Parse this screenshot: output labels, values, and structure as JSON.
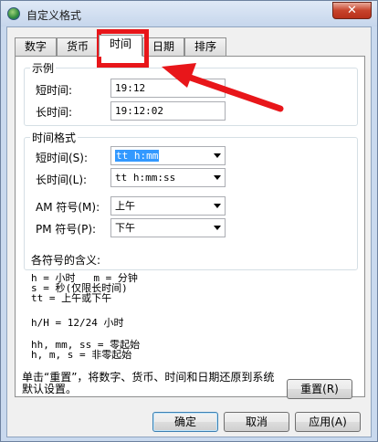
{
  "window": {
    "title": "自定义格式",
    "close_label": "✕"
  },
  "tabs": [
    {
      "label": "数字"
    },
    {
      "label": "货币"
    },
    {
      "label": "时间"
    },
    {
      "label": "日期"
    },
    {
      "label": "排序"
    }
  ],
  "example": {
    "title": "示例",
    "short_label": "短时间:",
    "short_value": "19:12",
    "long_label": "长时间:",
    "long_value": "19:12:02"
  },
  "time_format": {
    "title": "时间格式",
    "short_label": "短时间(S):",
    "short_value": "tt h:mm",
    "long_label": "长时间(L):",
    "long_value": "tt h:mm:ss",
    "am_label": "AM 符号(M):",
    "am_value": "上午",
    "pm_label": "PM 符号(P):",
    "pm_value": "下午"
  },
  "notes": {
    "title": "各符号的含义:",
    "line1": "h = 小时   m = 分钟",
    "line2": "s = 秒(仅限长时间)",
    "line3": "tt = 上午或下午",
    "line4": "h/H = 12/24 小时",
    "line5": "hh, mm, ss = 零起始",
    "line6": "h, m, s = 非零起始"
  },
  "footer": {
    "text": "单击“重置”，将数字、货币、时间和日期还原到系统默认设置。",
    "reset_label": "重置(R)"
  },
  "buttons": {
    "ok": "确定",
    "cancel": "取消",
    "apply": "应用(A)"
  },
  "colors": {
    "annotation": "#e8161a",
    "selection": "#3399ff"
  }
}
